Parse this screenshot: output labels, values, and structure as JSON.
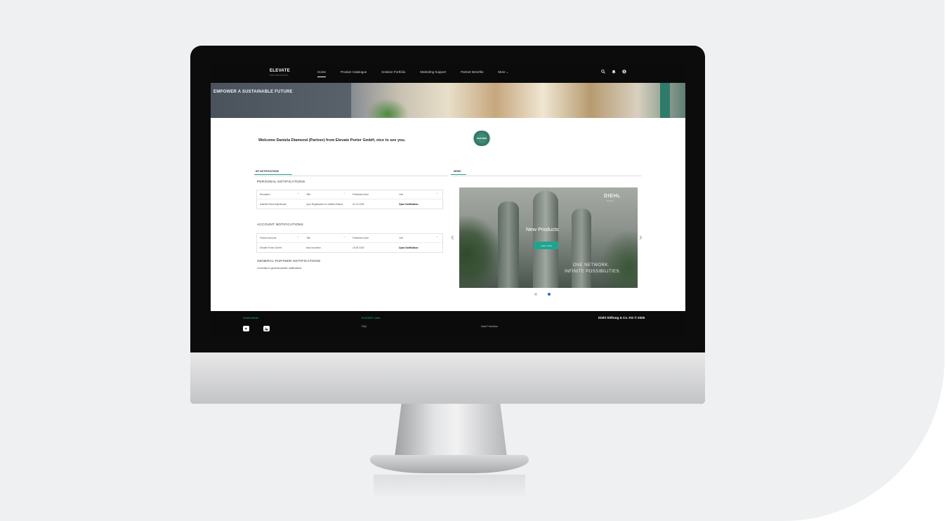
{
  "nav": {
    "logo": "ELEVATE",
    "logo_sub": "PARTNER PORTAL",
    "items": [
      "Home",
      "Product Catalogue",
      "Solution Portfolio",
      "Marketing Support",
      "Partner Benefits",
      "More"
    ],
    "icons": [
      "search-icon",
      "bell-icon",
      "user-icon"
    ]
  },
  "hero": {
    "title": "EMPOWER A SUSTAINABLE FUTURE"
  },
  "welcome": {
    "text": "Welcome Daniela Diamond (Partner) from Elevate Porter GmbH, nice to see you.",
    "badge": "PARTNER"
  },
  "notifications": {
    "section_label": "MY NOTIFICATIONS",
    "personal": {
      "title": "PERSONAL NOTIFICATIONS",
      "header": [
        "Reception",
        "Title",
        "Published since",
        "Link"
      ],
      "row": [
        "Isabelle Reiners@elevate",
        "Quiz Registration for Utilities Basics",
        "01.10.2025",
        "Open Notification"
      ]
    },
    "account": {
      "title": "ACCOUNT NOTIFICATIONS",
      "header": [
        "Partner Account",
        "Title",
        "Published since",
        "Link"
      ],
      "row": [
        "Elevate Porter GmbH",
        "New Incentive",
        "15.09.2025",
        "Open Notification"
      ]
    },
    "general": {
      "title": "GENERAL PARTNER NOTIFICATIONS",
      "note": "Currently no general partner notifications."
    }
  },
  "news": {
    "section_label": "NEWS",
    "brand": "DIEHL",
    "brand_sub": "Metering",
    "slide_title": "New Products",
    "button": "Learn more",
    "tagline_1": "ONE NETWORK.",
    "tagline_2": "INFINITE POSSIBILITIES.",
    "prev_arrow": "‹",
    "next_arrow": "›",
    "active_dot": 1,
    "dot_count": 2,
    "colors": {
      "accent": "#1fa58f",
      "dot_active": "#1f6fd1",
      "dot_inactive": "#c9c9c9"
    }
  },
  "footer": {
    "social_title": "Social Media",
    "links_title": "ELEVATE Links",
    "links": [
      "FAQ",
      "Data Protection"
    ],
    "copyright": "Diehl Stiftung & Co. KG © 2025",
    "social_icons": [
      "youtube-icon",
      "linkedin-icon"
    ]
  }
}
